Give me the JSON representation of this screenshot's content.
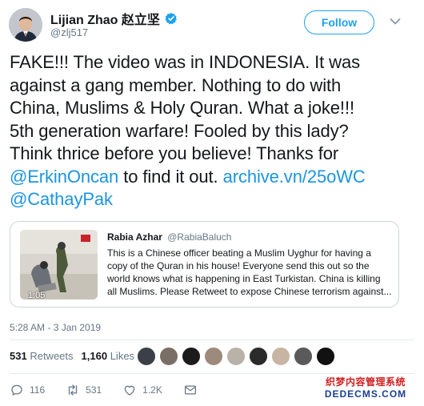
{
  "author": {
    "name": "Lijian Zhao 赵立坚",
    "handle": "@zlj517"
  },
  "follow_label": "Follow",
  "tweet": {
    "line1": "FAKE!!! The video was in INDONESIA. It was",
    "line2": "against a gang member. Nothing to do with",
    "line3": "China, Muslims & Holy Quran. What a joke!!!",
    "line4": "5th generation warfare! Fooled by this lady?",
    "line5": "Think thrice before you believe! Thanks for",
    "mention1": "@ErkinOncan",
    "line6_mid": " to find it out. ",
    "link": "archive.vn/25oWC",
    "mention2": "@CathayPak"
  },
  "quote": {
    "name": "Rabia Azhar",
    "handle": "@RabiaBaluch",
    "text": "This is a Chinese officer beating a Muslim Uyghur for having a copy of the Quran in his house! Everyone send this out so the world knows what is happening in East Turkistan. China is killing all Muslims. Please Retweet to expose Chinese terrorism against...",
    "video_time": "1:05"
  },
  "timestamp": "5:28 AM - 3 Jan 2019",
  "stats": {
    "retweets_count": "531",
    "retweets_label": "Retweets",
    "likes_count": "1,160",
    "likes_label": "Likes"
  },
  "actions": {
    "replies": "116",
    "retweets": "531",
    "likes": "1.2K"
  },
  "watermark": {
    "line1": "织梦内容管理系统",
    "line2": "DEDECMS.COM"
  },
  "colors": {
    "link": "#1b95e0",
    "follow": "#1da1f2",
    "verified": "#1da1f2",
    "secondary_text": "#657786"
  }
}
